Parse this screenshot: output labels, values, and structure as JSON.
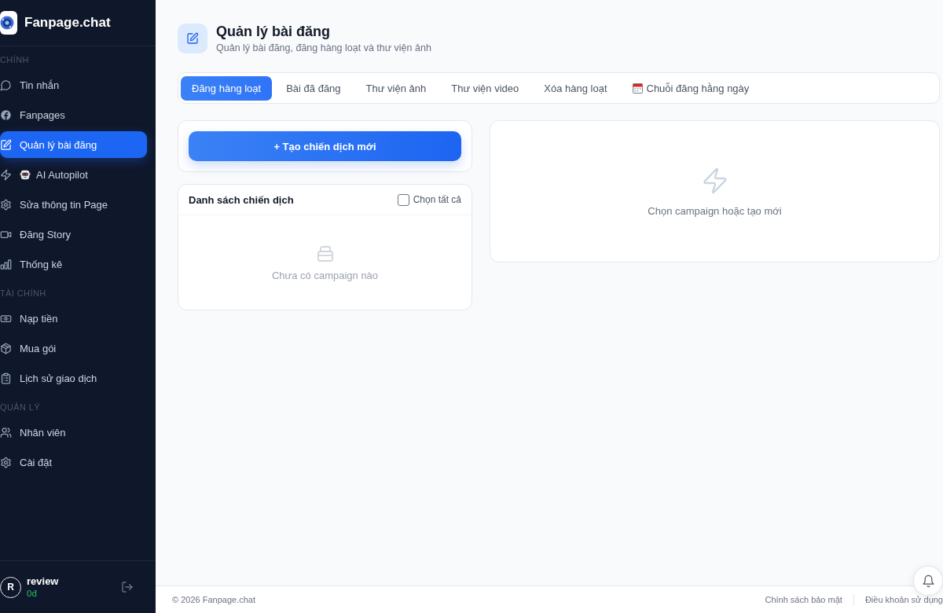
{
  "sidebar": {
    "brand": "Fanpage.chat",
    "sections": [
      {
        "title": "CHÍNH",
        "items": [
          {
            "label": "Tin nhắn",
            "selected": false
          },
          {
            "label": "Fanpages",
            "selected": false
          },
          {
            "label": "Quản lý bài đăng",
            "selected": true
          },
          {
            "label": "AI Autopilot",
            "selected": false
          },
          {
            "label": "Sửa thông tin Page",
            "selected": false
          },
          {
            "label": "Đăng Story",
            "selected": false
          },
          {
            "label": "Thống kê",
            "selected": false
          }
        ]
      },
      {
        "title": "TÀI CHÍNH",
        "items": [
          {
            "label": "Nạp tiền",
            "selected": false
          },
          {
            "label": "Mua gói",
            "selected": false
          },
          {
            "label": "Lịch sử giao dịch",
            "selected": false
          }
        ]
      },
      {
        "title": "QUẢN LÝ",
        "items": [
          {
            "label": "Nhân viên",
            "selected": false
          },
          {
            "label": "Cài đặt",
            "selected": false
          }
        ]
      }
    ],
    "user": {
      "avatar_initial": "R",
      "name": "review",
      "balance": "0đ"
    }
  },
  "page_header": {
    "title": "Quản lý bài đăng",
    "subtitle": "Quản lý bài đăng, đăng hàng loạt và thư viện ảnh"
  },
  "tabs": [
    {
      "label": "Đăng hàng loạt",
      "selected": true
    },
    {
      "label": "Bài đã đăng",
      "selected": false
    },
    {
      "label": "Thư viện ảnh",
      "selected": false
    },
    {
      "label": "Thư viện video",
      "selected": false
    },
    {
      "label": "Xóa hàng loạt",
      "selected": false
    },
    {
      "label": "Chuỗi đăng hằng ngày",
      "selected": false
    }
  ],
  "create_button": "+ Tạo chiến dịch mới",
  "campaign_list": {
    "title": "Danh sách chiến dịch",
    "select_all": {
      "label": "Chọn tất cả",
      "checked": false
    },
    "empty_text": "Chưa có campaign nào"
  },
  "detail_panel": {
    "empty_text": "Chọn campaign hoặc tạo mới"
  },
  "footer": {
    "copyright": "© 2026 Fanpage.chat",
    "links": [
      "Chính sách bảo mật",
      "Điều khoản sử dụng"
    ]
  }
}
